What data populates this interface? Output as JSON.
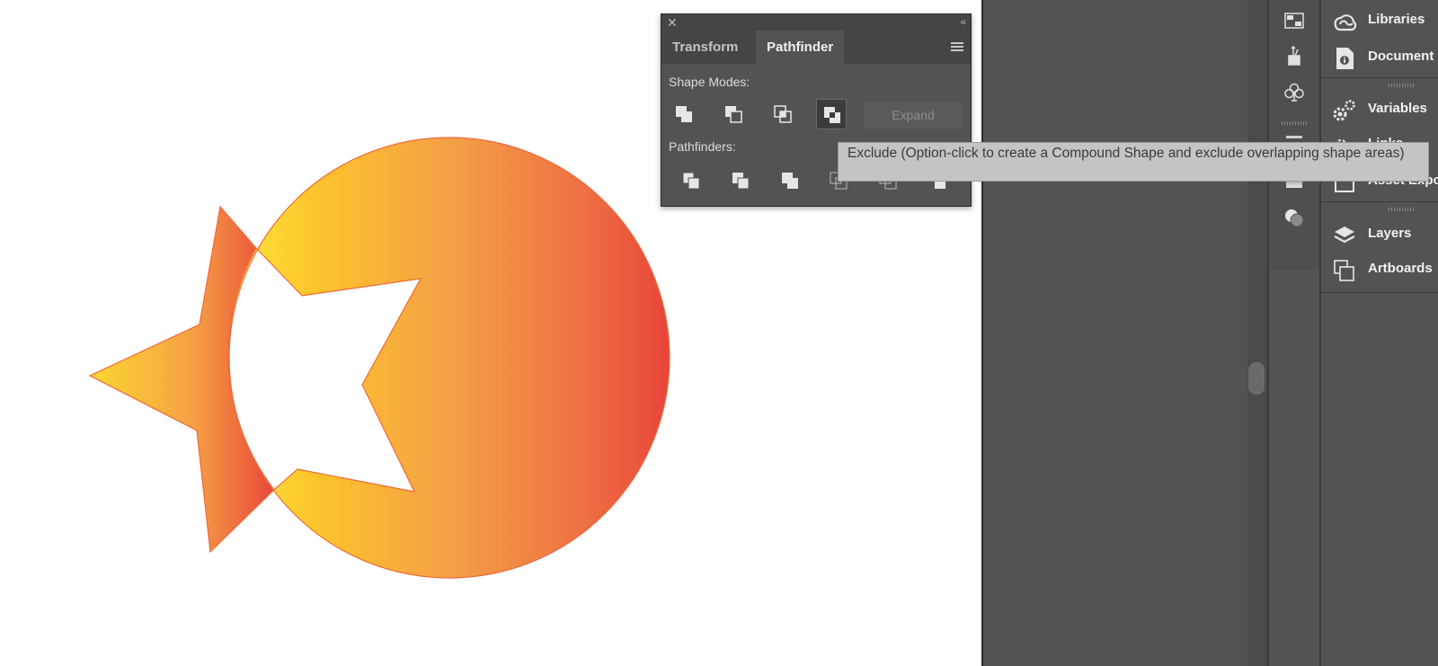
{
  "pathfinder_panel": {
    "close_icon": "close-icon",
    "collapse_icon": "double-chevron-left-icon",
    "tabs": [
      {
        "label": "Transform",
        "active": false
      },
      {
        "label": "Pathfinder",
        "active": true
      }
    ],
    "menu_icon": "hamburger-menu-icon",
    "shape_modes_label": "Shape Modes:",
    "shape_mode_buttons": [
      "unite-icon",
      "minus-front-icon",
      "intersect-icon",
      "exclude-icon"
    ],
    "selected_shape_mode": "exclude-icon",
    "expand_label": "Expand",
    "pathfinders_label": "Pathfinders:",
    "pathfinder_buttons": [
      "divide-icon",
      "trim-icon",
      "merge-icon",
      "crop-icon",
      "outline-icon",
      "minus-back-icon"
    ]
  },
  "tooltip": {
    "text": "Exclude (Option-click to create a Compound Shape and exclude overlapping shape areas)"
  },
  "dock": {
    "icon_strip": [
      "swatch-grid-icon",
      "brush-icon",
      "club-symbol-icon",
      "gradient-icon",
      "transparency-icon",
      "appearance-circles-icon"
    ],
    "panels": [
      {
        "label": "Libraries",
        "icon": "creative-cloud-libraries-icon"
      },
      {
        "label": "Document",
        "icon": "document-info-icon"
      },
      {
        "label": "Variables",
        "icon": "gears-icon"
      },
      {
        "label": "Links",
        "icon": "links-icon"
      },
      {
        "label": "Asset Export",
        "icon": "asset-export-icon"
      },
      {
        "label": "Layers",
        "icon": "layers-icon"
      },
      {
        "label": "Artboards",
        "icon": "artboards-icon"
      }
    ]
  },
  "artwork": {
    "gradient_colors": [
      "#fde73d",
      "#fbbd2e",
      "#f29a4a",
      "#ec6b42",
      "#e84a3c"
    ],
    "stroke_color": "#ee6a3a"
  }
}
